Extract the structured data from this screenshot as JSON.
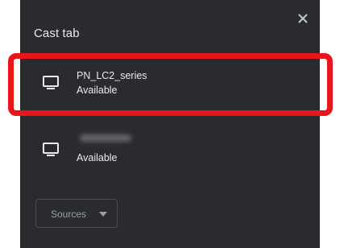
{
  "dialog": {
    "title": "Cast tab",
    "close_icon": "close-icon"
  },
  "sinks": [
    {
      "name": "PN_LC2_series",
      "status": "Available",
      "icon": "tv-icon",
      "highlighted": true
    },
    {
      "name": "",
      "status": "Available",
      "icon": "tv-icon",
      "name_obscured": true
    }
  ],
  "footer": {
    "sources_label": "Sources",
    "sources_icon": "caret-down-icon"
  },
  "colors": {
    "background": "#2a2b2e",
    "text": "#e8eaed",
    "muted_text": "#9aa0a6",
    "highlight_box": "#e8151a"
  }
}
